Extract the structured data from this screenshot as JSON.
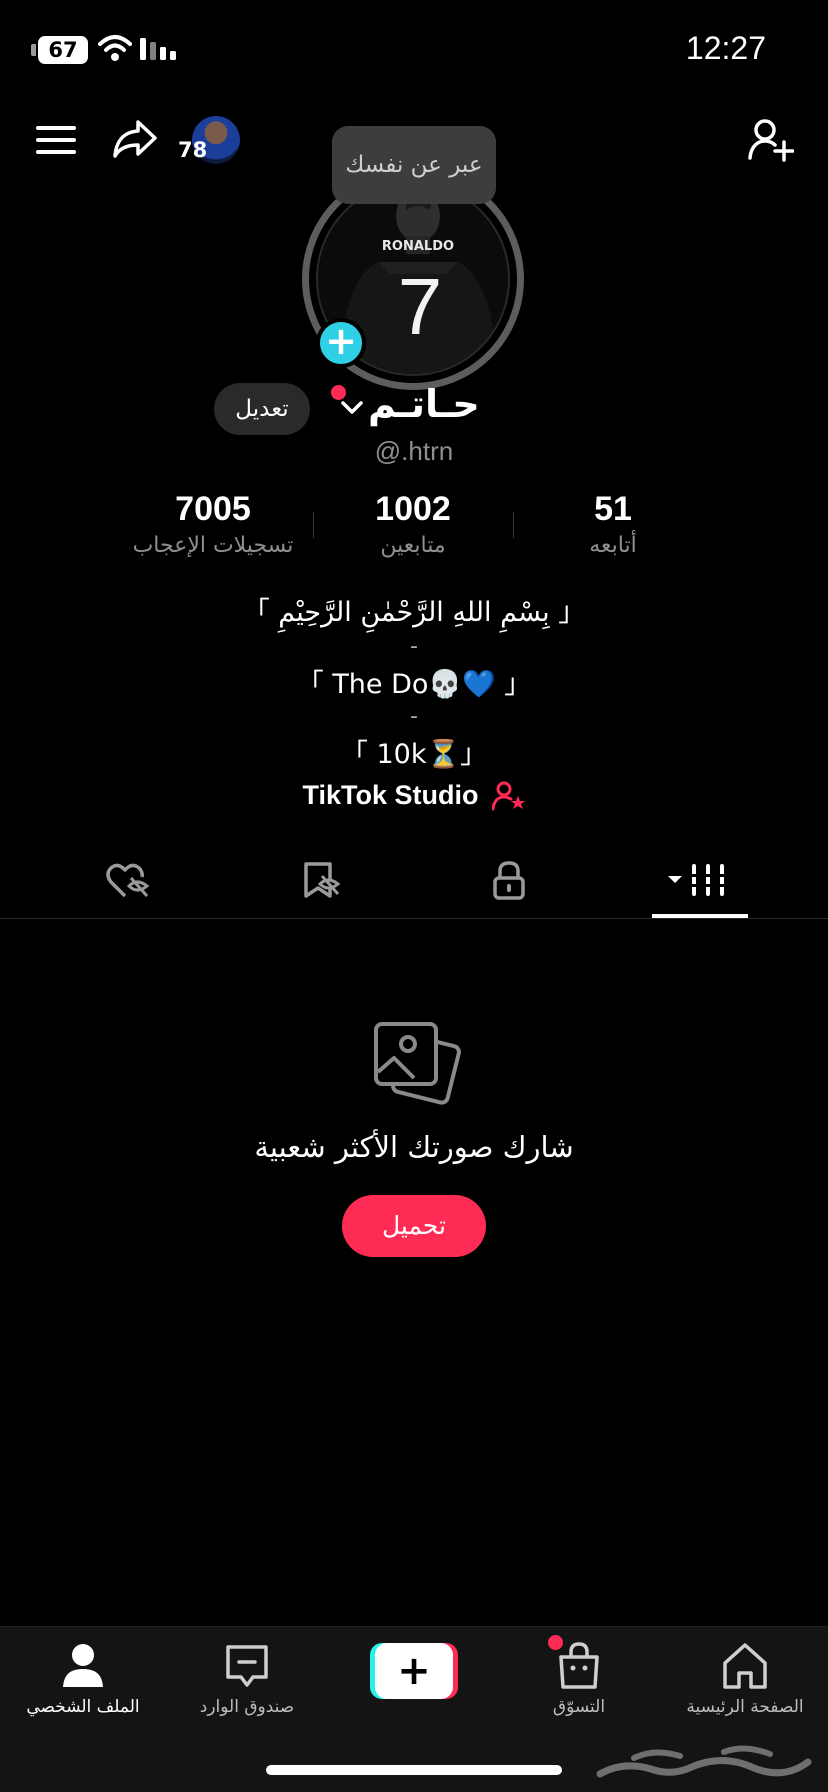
{
  "status_bar": {
    "battery": "67",
    "time": "12:27"
  },
  "header": {
    "friend_count": "78",
    "tooltip": "عبر عن نفسك"
  },
  "profile": {
    "name": "حـاتـم",
    "username": "@.htrn",
    "edit_label": "تعديل",
    "avatar_text": "RONALDO",
    "avatar_number": "7"
  },
  "stats": [
    {
      "value": "7005",
      "label": "تسجيلات الإعجاب"
    },
    {
      "value": "1002",
      "label": "متابعين"
    },
    {
      "value": "51",
      "label": "أتابعه"
    }
  ],
  "bio": {
    "line1": "「 بِسْمِ اللهِ الرَّحْمٰنِ الرَّحِيْمِ 」",
    "dash1": "-",
    "line2": "「 The Do💀💙 」",
    "dash2": "-",
    "line3": "「 10k⏳」"
  },
  "studio": {
    "label": "TikTok Studio"
  },
  "tabs": [
    {
      "icon": "grid-icon",
      "active": true
    },
    {
      "icon": "lock-icon"
    },
    {
      "icon": "bookmark-icon"
    },
    {
      "icon": "liked-icon"
    }
  ],
  "empty_state": {
    "title": "شارك صورتك الأكثر شعبية",
    "upload_label": "تحميل"
  },
  "bottom_nav": {
    "home": "الصفحة الرئيسية",
    "shop": "التسوّق",
    "create": "+",
    "inbox": "صندوق الوارد",
    "profile": "الملف الشخصي"
  },
  "colors": {
    "accent": "#fe2c55",
    "cyan": "#25f4ee",
    "plus_badge": "#2fd0e6"
  }
}
